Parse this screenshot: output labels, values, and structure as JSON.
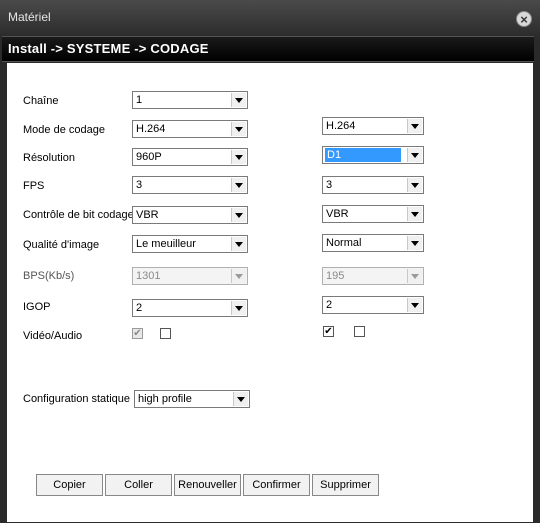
{
  "window": {
    "title": "Matériel",
    "close_symbol": "×"
  },
  "header": {
    "breadcrumb": "Install -> SYSTEME -> CODAGE"
  },
  "labels": {
    "channel": "Chaîne",
    "encode_mode": "Mode de codage",
    "resolution": "Résolution",
    "fps": "FPS",
    "bitrate_control": "Contrôle de bit codage",
    "image_quality": "Qualité d'image",
    "bps": "BPS(Kb/s)",
    "igop": "IGOP",
    "video_audio": "Vidéo/Audio",
    "static_config": "Configuration statique"
  },
  "main_stream": {
    "channel": "1",
    "encode_mode": "H.264",
    "resolution": "960P",
    "fps": "3",
    "bitrate_control": "VBR",
    "image_quality": "Le meuilleur",
    "bps": "1301",
    "igop": "2",
    "video_checked": true,
    "audio_checked": false
  },
  "extra_stream": {
    "encode_mode": "H.264",
    "resolution": "D1",
    "fps": "3",
    "bitrate_control": "VBR",
    "image_quality": "Normal",
    "bps": "195",
    "igop": "2",
    "video_checked": true,
    "audio_checked": false
  },
  "static_config": {
    "value": "high profile"
  },
  "buttons": {
    "copy": "Copier",
    "paste": "Coller",
    "renew": "Renouveller",
    "confirm": "Confirmer",
    "delete": "Supprimer"
  },
  "glyphs": {
    "check": "✔"
  }
}
